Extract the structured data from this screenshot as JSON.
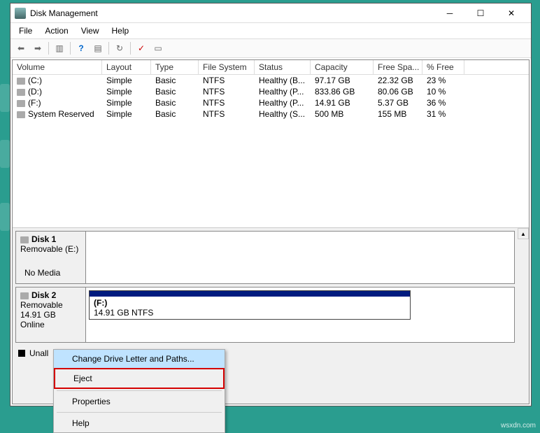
{
  "window": {
    "title": "Disk Management"
  },
  "menu": {
    "file": "File",
    "action": "Action",
    "view": "View",
    "help": "Help"
  },
  "columns": {
    "volume": "Volume",
    "layout": "Layout",
    "type": "Type",
    "fs": "File System",
    "status": "Status",
    "capacity": "Capacity",
    "free": "Free Spa...",
    "pct": "% Free"
  },
  "volumes": [
    {
      "name": "(C:)",
      "layout": "Simple",
      "type": "Basic",
      "fs": "NTFS",
      "status": "Healthy (B...",
      "capacity": "97.17 GB",
      "free": "22.32 GB",
      "pct": "23 %"
    },
    {
      "name": "(D:)",
      "layout": "Simple",
      "type": "Basic",
      "fs": "NTFS",
      "status": "Healthy (P...",
      "capacity": "833.86 GB",
      "free": "80.06 GB",
      "pct": "10 %"
    },
    {
      "name": "(F:)",
      "layout": "Simple",
      "type": "Basic",
      "fs": "NTFS",
      "status": "Healthy (P...",
      "capacity": "14.91 GB",
      "free": "5.37 GB",
      "pct": "36 %"
    },
    {
      "name": "System Reserved",
      "layout": "Simple",
      "type": "Basic",
      "fs": "NTFS",
      "status": "Healthy (S...",
      "capacity": "500 MB",
      "free": "155 MB",
      "pct": "31 %"
    }
  ],
  "disks": {
    "d1": {
      "title": "Disk 1",
      "sub": "Removable (E:)",
      "body": "No Media"
    },
    "d2": {
      "title": "Disk 2",
      "sub1": "Removable",
      "sub2": "14.91 GB",
      "sub3": "Online",
      "part_label": "(F:)",
      "part_detail": "14.91 GB NTFS"
    }
  },
  "legend": {
    "unalloc": "Unall"
  },
  "context": {
    "change": "Change Drive Letter and Paths...",
    "eject": "Eject",
    "props": "Properties",
    "help": "Help"
  },
  "watermark": "wsxdn.com"
}
